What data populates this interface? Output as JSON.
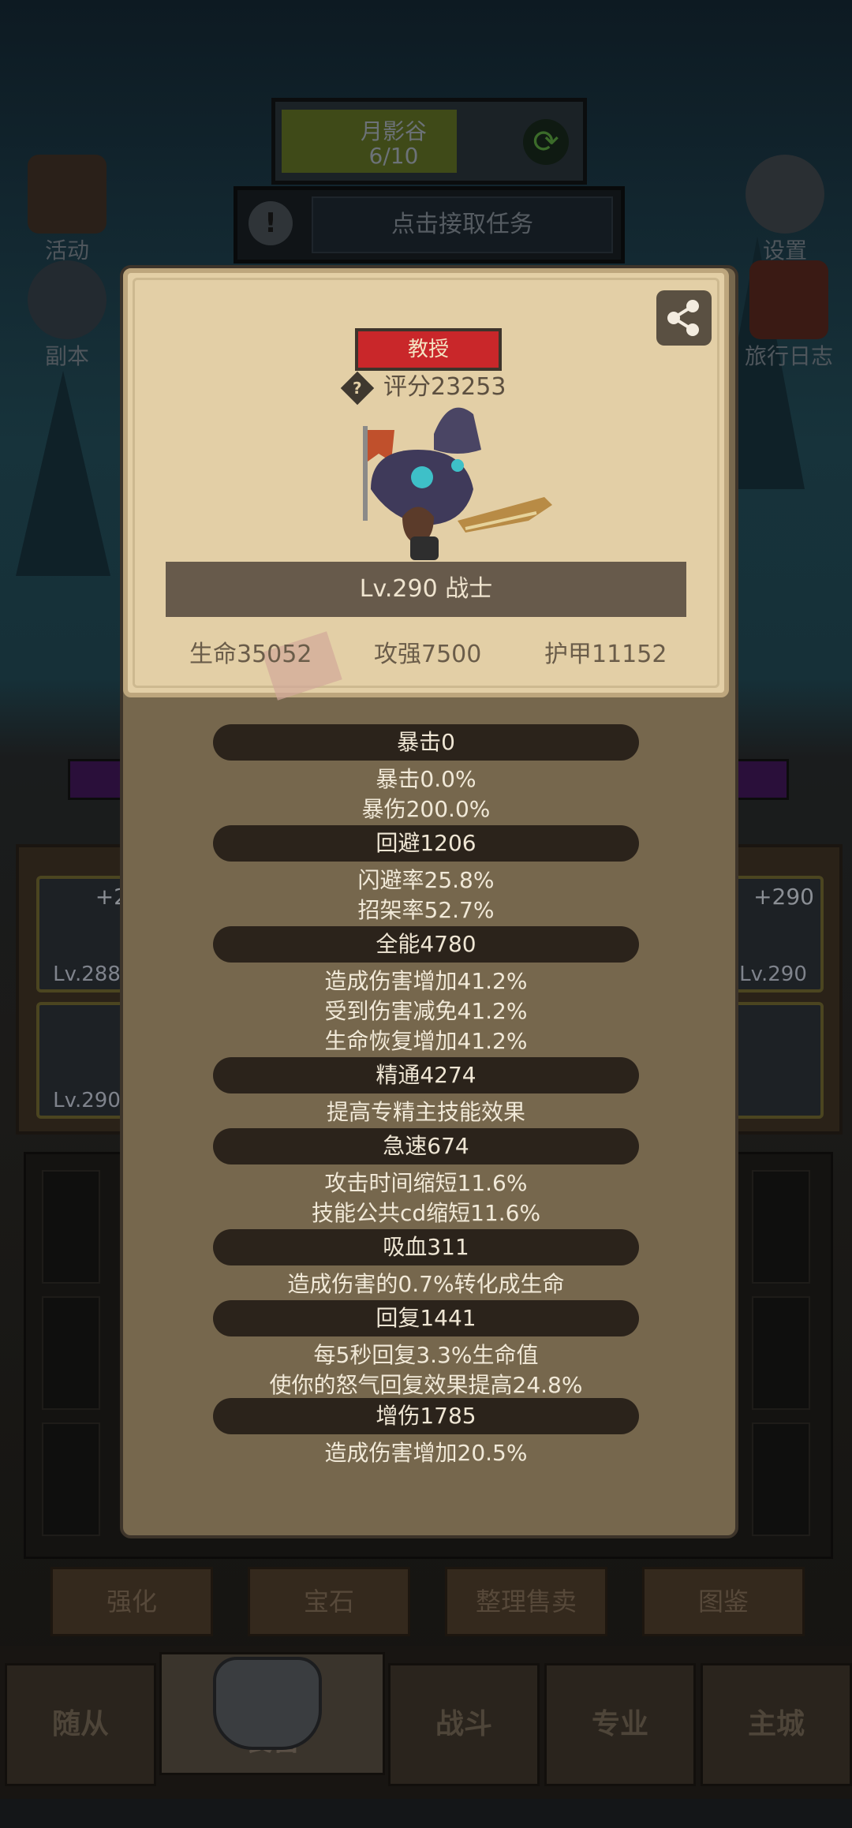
{
  "hud": {
    "zone_name": "月影谷",
    "zone_progress": "6/10",
    "zone_progress_value": 0.6,
    "task_prompt": "点击接取任务",
    "refresh_icon": "refresh-icon",
    "alert_icon": "exclamation-icon"
  },
  "side_buttons": {
    "activity": "活动",
    "dungeon": "副本",
    "settings": "设置",
    "travel_log": "旅行日志"
  },
  "background_equipment": [
    {
      "level": "Lv.288",
      "plus": "+2"
    },
    {
      "level": "Lv.290",
      "plus": ""
    },
    {
      "level": "Lv.290",
      "plus": "+290"
    }
  ],
  "actions": [
    "强化",
    "宝石",
    "整理售卖",
    "图鉴"
  ],
  "nav": [
    "随从",
    "装备",
    "战斗",
    "专业",
    "主城"
  ],
  "hero": {
    "title": "教授",
    "score": "评分23253",
    "level_class": "Lv.290 战士",
    "stats": {
      "hp": "生命35052",
      "attack": "攻强7500",
      "armor": "护甲11152"
    },
    "share_icon": "share-icon",
    "help_icon": "question-icon"
  },
  "sections": [
    {
      "head": "暴击0",
      "lines": [
        "暴击0.0%",
        "暴伤200.0%"
      ]
    },
    {
      "head": "回避1206",
      "lines": [
        "闪避率25.8%",
        "招架率52.7%"
      ]
    },
    {
      "head": "全能4780",
      "lines": [
        "造成伤害增加41.2%",
        "受到伤害减免41.2%",
        "生命恢复增加41.2%"
      ]
    },
    {
      "head": "精通4274",
      "lines": [
        "提高专精主技能效果"
      ]
    },
    {
      "head": "急速674",
      "lines": [
        "攻击时间缩短11.6%",
        "技能公共cd缩短11.6%"
      ]
    },
    {
      "head": "吸血311",
      "lines": [
        "造成伤害的0.7%转化成生命"
      ]
    },
    {
      "head": "回复1441",
      "lines": [
        "每5秒回复3.3%生命值",
        "使你的怒气回复效果提高24.8%"
      ]
    },
    {
      "head": "增伤1785",
      "lines": [
        "造成伤害增加20.5%"
      ]
    }
  ]
}
